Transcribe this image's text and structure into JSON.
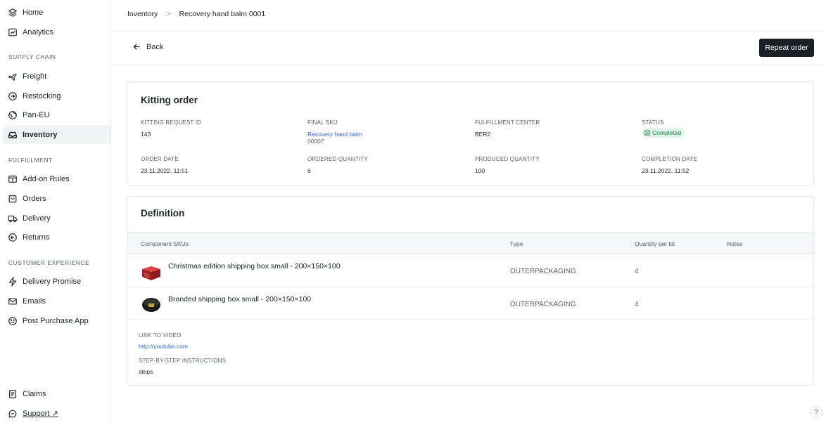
{
  "sidebar": {
    "top_items": [
      {
        "label": "Home",
        "icon": "layers-icon"
      },
      {
        "label": "Analytics",
        "icon": "chart-icon"
      }
    ],
    "sections": [
      {
        "title": "SUPPLY CHAIN",
        "items": [
          {
            "label": "Freight",
            "icon": "plane-icon"
          },
          {
            "label": "Restocking",
            "icon": "arrow-circle-icon"
          },
          {
            "label": "Pan-EU",
            "icon": "globe-icon"
          },
          {
            "label": "Inventory",
            "icon": "inbox-icon",
            "active": true
          }
        ]
      },
      {
        "title": "FULFILLMENT",
        "items": [
          {
            "label": "Add-on Rules",
            "icon": "add-on-icon"
          },
          {
            "label": "Orders",
            "icon": "bag-icon"
          },
          {
            "label": "Delivery",
            "icon": "truck-icon"
          },
          {
            "label": "Returns",
            "icon": "return-icon"
          }
        ]
      },
      {
        "title": "CUSTOMER EXPERIENCE",
        "items": [
          {
            "label": "Delivery Promise",
            "icon": "bolt-icon"
          },
          {
            "label": "Emails",
            "icon": "mail-icon"
          },
          {
            "label": "Post Purchase App",
            "icon": "smile-icon"
          }
        ]
      }
    ],
    "bottom_items": [
      {
        "label": "Claims",
        "icon": "document-icon"
      },
      {
        "label": "Support ↗",
        "icon": "chat-icon"
      }
    ]
  },
  "breadcrumb": [
    "Inventory",
    "Recovery hand balm 0001"
  ],
  "breadcrumb_sep": ">",
  "back_label": "Back",
  "repeat_label": "Repeat order",
  "kitting": {
    "title": "Kitting order",
    "fields": [
      {
        "label": "KITTING REQUEST ID",
        "value": "143"
      },
      {
        "label": "FINAL SKU",
        "value": "Recovery hand balm",
        "value2": "00007"
      },
      {
        "label": "FULFILLMENT CENTER",
        "value": "BER2"
      },
      {
        "label": "STATUS",
        "value": "Completed"
      },
      {
        "label": "ORDER DATE",
        "value": "23.11.2022, 11:51"
      },
      {
        "label": "ORDERED QUANTITY",
        "value": "6"
      },
      {
        "label": "PRODUCED QUANTITY",
        "value": "100"
      },
      {
        "label": "COMPLETION DATE",
        "value": "23.11.2022, 11:52"
      }
    ]
  },
  "definition": {
    "title": "Definition",
    "headers": [
      "Component SKUs",
      "Type",
      "Quantity per kit",
      "Notes"
    ],
    "rows": [
      {
        "name": "Christmas edition shipping box small - 200×150×100",
        "type": "OUTERPACKAGING",
        "qty": "4",
        "notes": "",
        "color": "#b32424"
      },
      {
        "name": "Branded shipping box small - 200×150×100",
        "type": "OUTERPACKAGING",
        "qty": "4",
        "notes": "",
        "color": "#1b1d1a"
      }
    ],
    "video_label": "LINK TO VIDEO",
    "video_value": "http://youtube.com",
    "steps_label": "STEP-BY-STEP INSTRUCTIONS",
    "steps_value": "steps"
  },
  "help": "?"
}
